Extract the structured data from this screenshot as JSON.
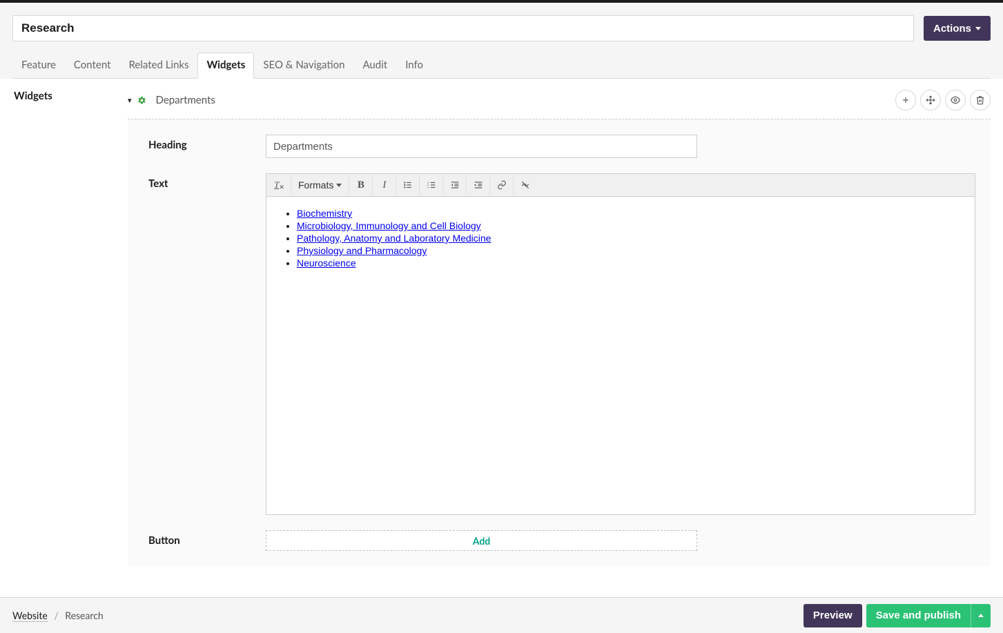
{
  "header": {
    "title_value": "Research",
    "actions_label": "Actions"
  },
  "tabs": [
    {
      "label": "Feature"
    },
    {
      "label": "Content"
    },
    {
      "label": "Related Links"
    },
    {
      "label": "Widgets",
      "active": true
    },
    {
      "label": "SEO & Navigation"
    },
    {
      "label": "Audit"
    },
    {
      "label": "Info"
    }
  ],
  "sidebar": {
    "section_title": "Widgets"
  },
  "widget": {
    "name": "Departments",
    "fields": {
      "heading_label": "Heading",
      "heading_value": "Departments",
      "text_label": "Text",
      "button_label": "Button",
      "add_label": "Add"
    },
    "toolbar": {
      "formats_label": "Formats"
    },
    "body_links": [
      "Biochemistry",
      "Microbiology, Immunology and Cell Biology",
      "Pathology, Anatomy and Laboratory Medicine",
      "Physiology and Pharmacology",
      "Neuroscience"
    ]
  },
  "footer": {
    "breadcrumb_root": "Website",
    "breadcrumb_current": "Research",
    "preview_label": "Preview",
    "save_label": "Save and publish"
  }
}
